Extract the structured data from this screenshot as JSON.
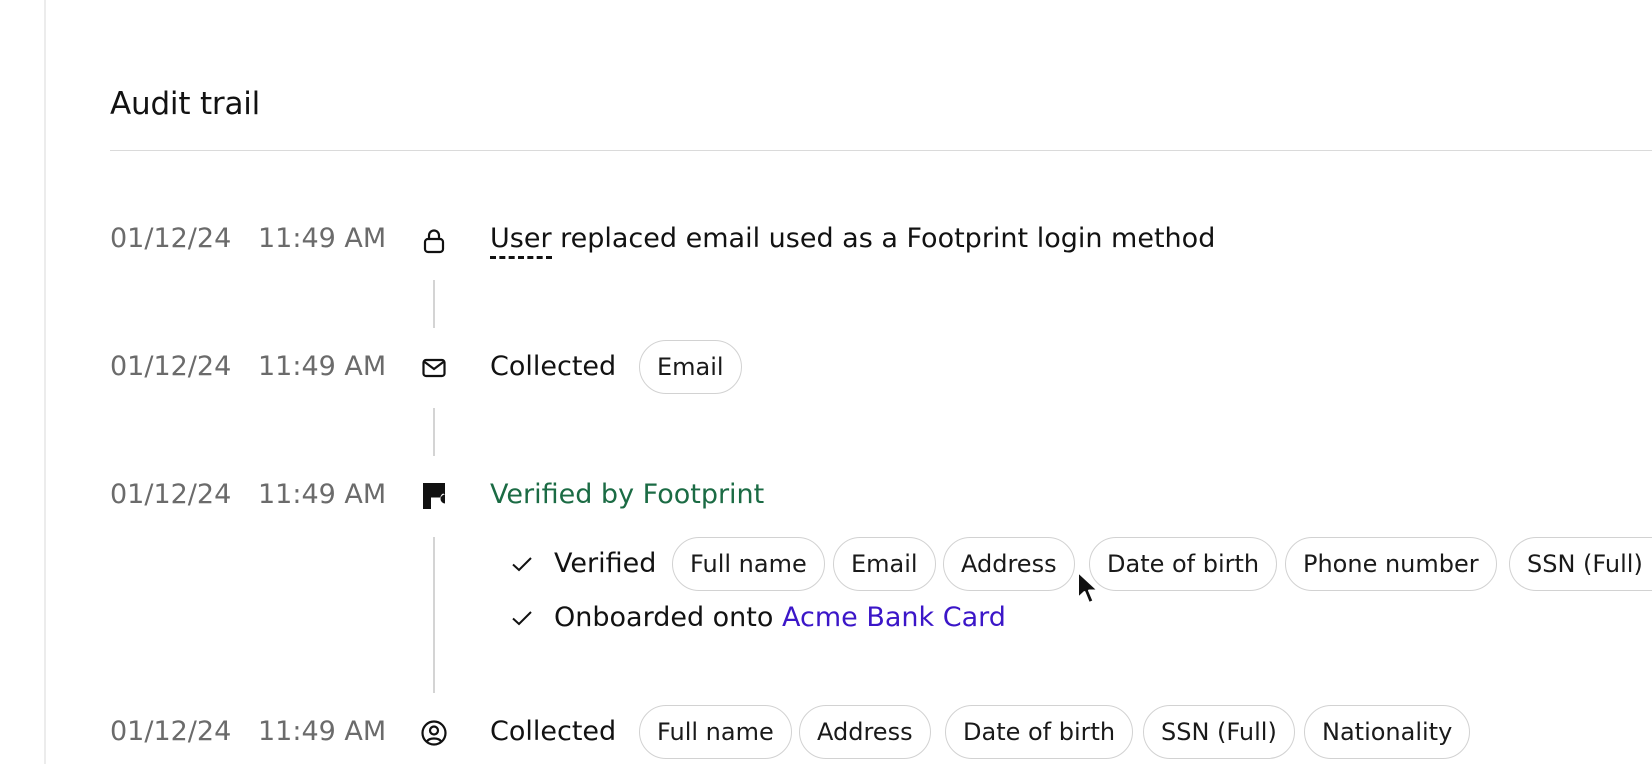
{
  "section": {
    "title": "Audit trail"
  },
  "events": [
    {
      "date": "01/12/24",
      "time": "11:49 AM",
      "icon": "lock-icon",
      "actor": "User",
      "text": " replaced email used as a Footprint login method"
    },
    {
      "date": "01/12/24",
      "time": "11:49 AM",
      "icon": "mail-icon",
      "label": "Collected",
      "chips": [
        "Email"
      ]
    },
    {
      "date": "01/12/24",
      "time": "11:49 AM",
      "icon": "footprint-logo-icon",
      "title": "Verified by Footprint",
      "verified_label": "Verified",
      "verified_chips": [
        "Full name",
        "Email",
        "Address",
        "Date of birth",
        "Phone number",
        "SSN (Full)"
      ],
      "onboarded_label": "Onboarded onto ",
      "onboarded_link": "Acme Bank Card"
    },
    {
      "date": "01/12/24",
      "time": "11:49 AM",
      "icon": "user-circle-icon",
      "label": "Collected",
      "chips": [
        "Full name",
        "Address",
        "Date of birth",
        "SSN (Full)",
        "Nationality"
      ]
    }
  ],
  "colors": {
    "verified_green": "#1b6b44",
    "link_purple": "#3b16c8",
    "muted_text": "#6b6b6b"
  }
}
